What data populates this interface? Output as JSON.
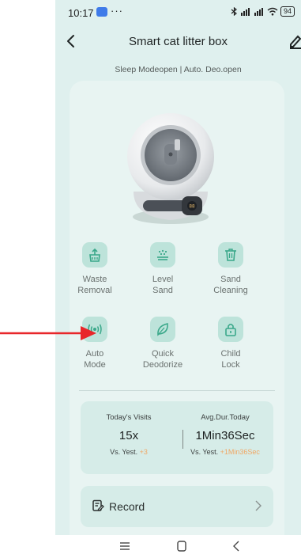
{
  "status_bar": {
    "time": "10:17",
    "dots": "···",
    "battery": "94"
  },
  "header": {
    "title": "Smart cat litter box"
  },
  "mode_status": "Sleep Modeopen | Auto. Deo.open",
  "controls": [
    {
      "line1": "Waste",
      "line2": "Removal",
      "icon": "waste-removal-icon"
    },
    {
      "line1": "Level",
      "line2": "Sand",
      "icon": "level-sand-icon"
    },
    {
      "line1": "Sand",
      "line2": "Cleaning",
      "icon": "trash-icon"
    },
    {
      "line1": "Auto",
      "line2": "Mode",
      "icon": "auto-mode-icon"
    },
    {
      "line1": "Quick",
      "line2": "Deodorize",
      "icon": "leaf-icon"
    },
    {
      "line1": "Child",
      "line2": "Lock",
      "icon": "lock-icon"
    }
  ],
  "stats": {
    "visits": {
      "label": "Today's Visits",
      "value": "15x",
      "vs_label": "Vs. Yest.",
      "delta": "+3"
    },
    "duration": {
      "label": "Avg.Dur.Today",
      "value": "1Min36Sec",
      "vs_label": "Vs. Yest.",
      "delta": "+1Min36Sec"
    }
  },
  "record": {
    "label": "Record"
  },
  "colors": {
    "background": "#dff0ee",
    "card": "#e8f4f2",
    "icon_tile": "#bde3da",
    "icon_stroke": "#3aa88a",
    "delta": "#f0a866",
    "annotation_arrow": "#e8262a"
  }
}
